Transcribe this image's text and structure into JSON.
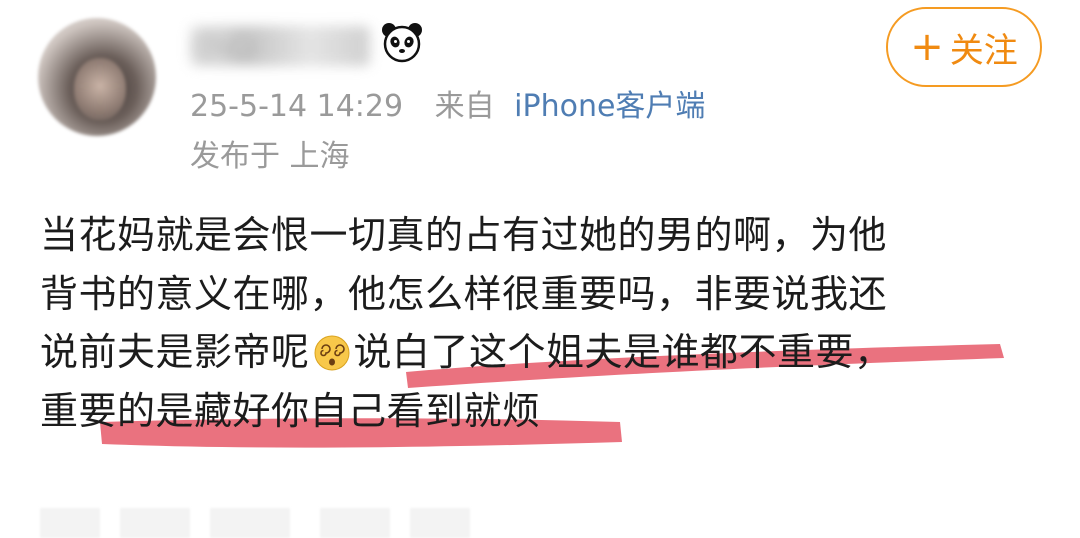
{
  "user": {
    "name_obscured": "小心",
    "badge_icon": "panda-icon",
    "follow_label": "关注",
    "follow_icon": "plus-icon"
  },
  "meta": {
    "timestamp": "25-5-14 14:29",
    "from_label": "来自",
    "client": "iPhone客户端",
    "location": "发布于 上海"
  },
  "post": {
    "lines": [
      "当花妈就是会恨一切真的占有过她的男的啊，为他",
      "背书的意义在哪，他怎么样很重要吗，非要说我还",
      "说前夫是影帝呢",
      "重要的是藏好你自己看到就烦"
    ],
    "line3_tail": "说白了这个姐夫是谁都不重要，",
    "emoji": "dizzy-face-emoji"
  },
  "colors": {
    "follow": "#f08a11",
    "client_link": "#4f7db3",
    "meta_gray": "#9a9a9a",
    "highlight": "#e23b4e"
  }
}
